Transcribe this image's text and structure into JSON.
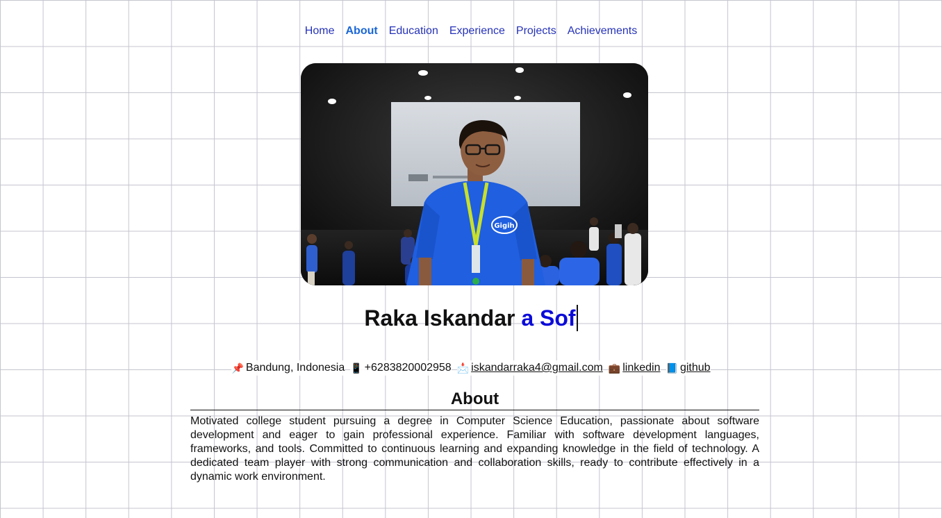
{
  "nav": {
    "items": [
      {
        "label": "Home",
        "active": false
      },
      {
        "label": "About",
        "active": true
      },
      {
        "label": "Education",
        "active": false
      },
      {
        "label": "Experience",
        "active": false
      },
      {
        "label": "Projects",
        "active": false
      },
      {
        "label": "Achievements",
        "active": false
      }
    ]
  },
  "profile": {
    "photo_alt": "Raka Iskandar",
    "shirt_text": "Gigih",
    "name": "Raka Iskandar",
    "typed_text": "a Sof"
  },
  "contacts": [
    {
      "icon": "pushpin-icon",
      "glyph": "📌",
      "text": "Bandung, Indonesia",
      "link": false
    },
    {
      "icon": "mobile-phone-icon",
      "glyph": "📱",
      "text": "+6283820002958",
      "link": false
    },
    {
      "icon": "envelope-icon",
      "glyph": "📩",
      "text": "iskandarraka4@gmail.com",
      "link": true
    },
    {
      "icon": "briefcase-icon",
      "glyph": "💼",
      "text": "linkedin",
      "link": true
    },
    {
      "icon": "book-icon",
      "glyph": "📘",
      "text": "github",
      "link": true
    }
  ],
  "about": {
    "heading": "About",
    "text": "Motivated college student pursuing a degree in Computer Science Education, passionate about software development and eager to gain professional experience. Familiar with software development languages, frameworks, and tools. Committed to continuous learning and expanding knowledge in the field of technology. A dedicated team player with strong communication and collaboration skills, ready to contribute effectively in a dynamic work environment."
  },
  "colors": {
    "nav_link": "#2532b8",
    "nav_active": "#1a66d6",
    "typed_text": "#0b0bd8",
    "grid_line": "#c4c4cf",
    "shirt": "#1f5fe0"
  }
}
